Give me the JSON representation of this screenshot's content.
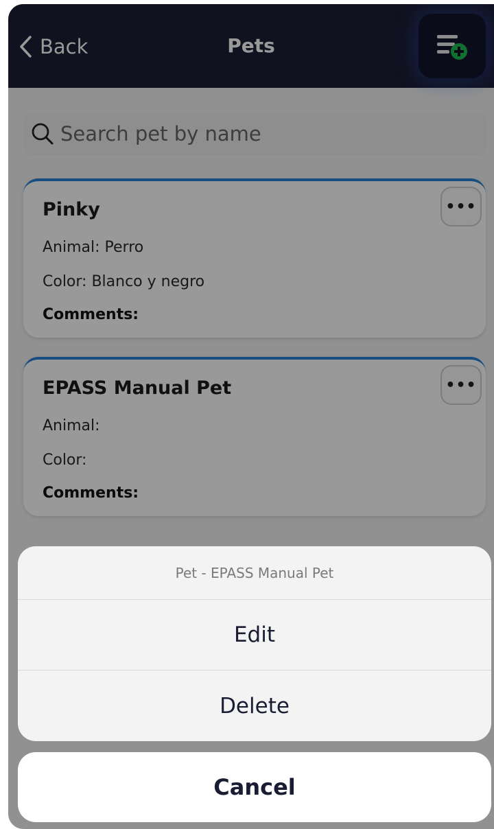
{
  "header": {
    "back_label": "Back",
    "title": "Pets",
    "add_icon": "list-add-icon",
    "add_icon_accent": "#1db954"
  },
  "search": {
    "placeholder": "Search pet by name",
    "value": ""
  },
  "pets": [
    {
      "name": "Pinky",
      "animal": "Animal: Perro",
      "color": "Color: Blanco y negro",
      "comments": "Comments:"
    },
    {
      "name": "EPASS Manual Pet",
      "animal": "Animal:",
      "color": "Color:",
      "comments": "Comments:"
    }
  ],
  "more_button_label": "•••",
  "action_sheet": {
    "title": "Pet - EPASS Manual Pet",
    "edit_label": "Edit",
    "delete_label": "Delete",
    "cancel_label": "Cancel"
  },
  "colors": {
    "header_bg": "#1c1e35",
    "card_accent": "#2a7fd4"
  }
}
